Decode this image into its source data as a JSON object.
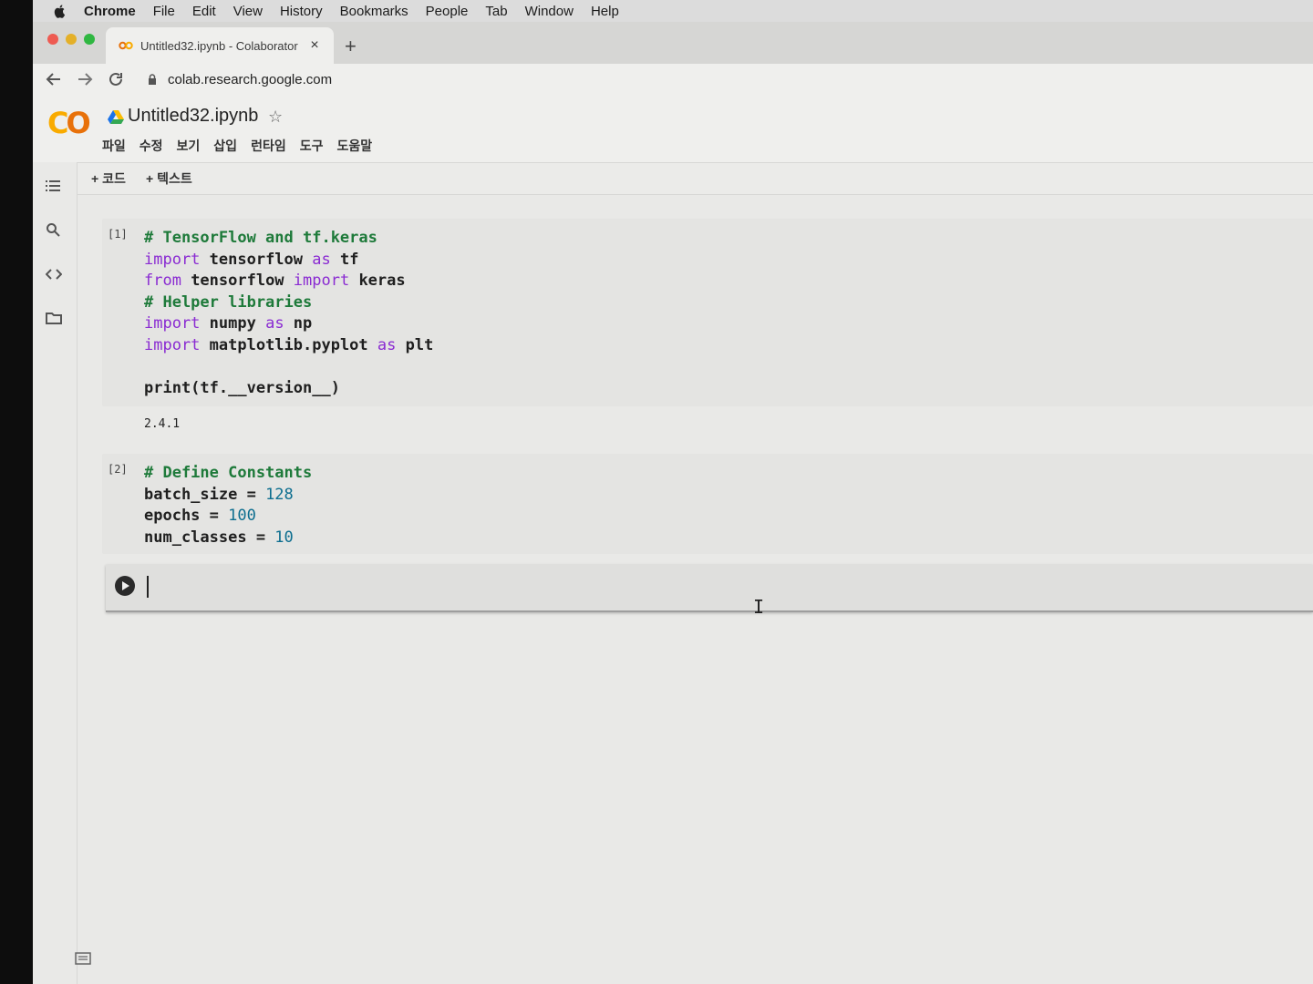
{
  "menubar": {
    "items": [
      "Chrome",
      "File",
      "Edit",
      "View",
      "History",
      "Bookmarks",
      "People",
      "Tab",
      "Window",
      "Help"
    ]
  },
  "browser": {
    "tab_title": "Untitled32.ipynb - Colaborator",
    "new_tab": "+",
    "close_tab": "×",
    "url": "colab.research.google.com"
  },
  "colab": {
    "notebook_title": "Untitled32.ipynb",
    "menu": [
      "파일",
      "수정",
      "보기",
      "삽입",
      "런타임",
      "도구",
      "도움말"
    ],
    "toolbar": {
      "add_code": "+ 코드",
      "add_text": "+ 텍스트"
    }
  },
  "cells": [
    {
      "exec_count": "[1]",
      "lines": [
        [
          {
            "t": "cm",
            "v": "# TensorFlow and tf.keras"
          }
        ],
        [
          {
            "t": "kw",
            "v": "import"
          },
          {
            "t": "",
            "v": " tensorflow "
          },
          {
            "t": "kw",
            "v": "as"
          },
          {
            "t": "",
            "v": " tf"
          }
        ],
        [
          {
            "t": "kw",
            "v": "from"
          },
          {
            "t": "",
            "v": " tensorflow "
          },
          {
            "t": "kw",
            "v": "import"
          },
          {
            "t": "",
            "v": " keras"
          }
        ],
        [
          {
            "t": "cm",
            "v": "# Helper libraries"
          }
        ],
        [
          {
            "t": "kw",
            "v": "import"
          },
          {
            "t": "",
            "v": " numpy "
          },
          {
            "t": "kw",
            "v": "as"
          },
          {
            "t": "",
            "v": " np"
          }
        ],
        [
          {
            "t": "kw",
            "v": "import"
          },
          {
            "t": "",
            "v": " matplotlib.pyplot "
          },
          {
            "t": "kw",
            "v": "as"
          },
          {
            "t": "",
            "v": " plt"
          }
        ],
        [],
        [
          {
            "t": "",
            "v": "print(tf.__version__)"
          }
        ]
      ],
      "output": "2.4.1"
    },
    {
      "exec_count": "[2]",
      "lines": [
        [
          {
            "t": "cm",
            "v": "# Define Constants"
          }
        ],
        [
          {
            "t": "",
            "v": "batch_size = "
          },
          {
            "t": "num",
            "v": "128"
          }
        ],
        [
          {
            "t": "",
            "v": "epochs = "
          },
          {
            "t": "num",
            "v": "100"
          }
        ],
        [
          {
            "t": "",
            "v": "num_classes = "
          },
          {
            "t": "num",
            "v": "10"
          }
        ]
      ]
    }
  ]
}
